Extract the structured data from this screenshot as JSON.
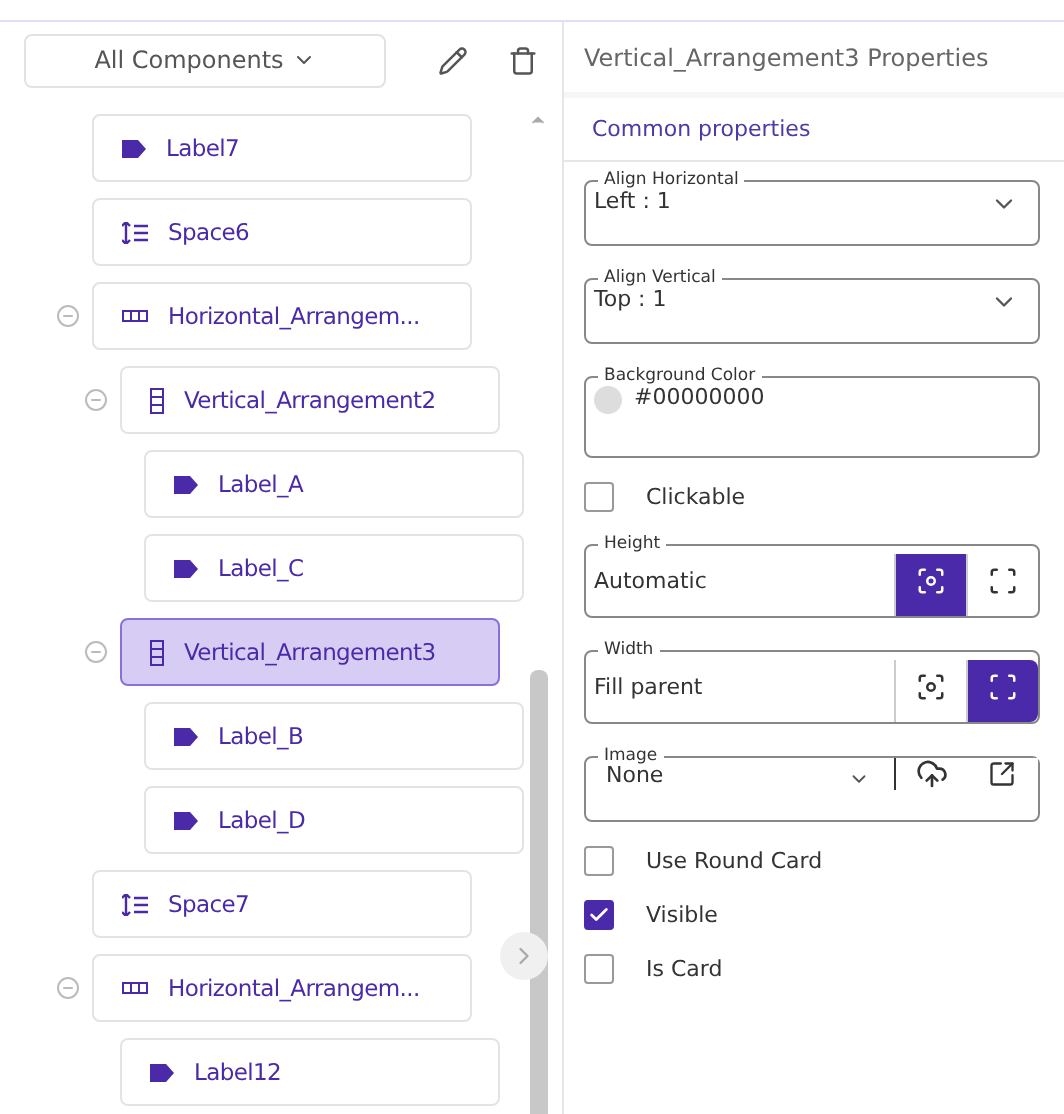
{
  "toolbar": {
    "filter": "All Components"
  },
  "tree": [
    {
      "name": "Label7",
      "kind": "label",
      "selected": false
    },
    {
      "name": "Space6",
      "kind": "space",
      "selected": false
    },
    {
      "name": "Horizontal_Arrangem...",
      "kind": "horizontal",
      "selected": false,
      "expanded": true,
      "children": [
        {
          "name": "Vertical_Arrangement2",
          "kind": "vertical",
          "selected": false,
          "expanded": true,
          "children": [
            {
              "name": "Label_A",
              "kind": "label",
              "selected": false
            },
            {
              "name": "Label_C",
              "kind": "label",
              "selected": false
            }
          ]
        },
        {
          "name": "Vertical_Arrangement3",
          "kind": "vertical",
          "selected": true,
          "expanded": true,
          "children": [
            {
              "name": "Label_B",
              "kind": "label",
              "selected": false
            },
            {
              "name": "Label_D",
              "kind": "label",
              "selected": false
            }
          ]
        }
      ]
    },
    {
      "name": "Space7",
      "kind": "space",
      "selected": false
    },
    {
      "name": "Horizontal_Arrangem...",
      "kind": "horizontal",
      "selected": false,
      "expanded": true,
      "children": [
        {
          "name": "Label12",
          "kind": "label",
          "selected": false
        }
      ]
    }
  ],
  "properties": {
    "title": "Vertical_Arrangement3 Properties",
    "section": "Common properties",
    "items": [
      {
        "kind": "select",
        "label": "Align Horizontal",
        "value": "Left : 1"
      },
      {
        "kind": "select",
        "label": "Align Vertical",
        "value": "Top : 1"
      },
      {
        "kind": "color",
        "label": "Background Color",
        "value": "#00000000"
      },
      {
        "kind": "checkbox",
        "label": "Clickable",
        "checked": false
      },
      {
        "kind": "size",
        "label": "Height",
        "value": "Automatic",
        "options": [
          {
            "kind": "automatic",
            "selected": true
          },
          {
            "kind": "fill",
            "selected": false
          }
        ]
      },
      {
        "kind": "size",
        "label": "Width",
        "value": "Fill parent",
        "options": [
          {
            "kind": "automatic",
            "selected": false
          },
          {
            "kind": "fill",
            "selected": true
          }
        ]
      },
      {
        "kind": "image",
        "label": "Image",
        "value": "None"
      },
      {
        "kind": "checkbox",
        "label": "Use Round Card",
        "checked": false
      },
      {
        "kind": "checkbox",
        "label": "Visible",
        "checked": true
      },
      {
        "kind": "checkbox",
        "label": "Is Card",
        "checked": false
      }
    ]
  }
}
